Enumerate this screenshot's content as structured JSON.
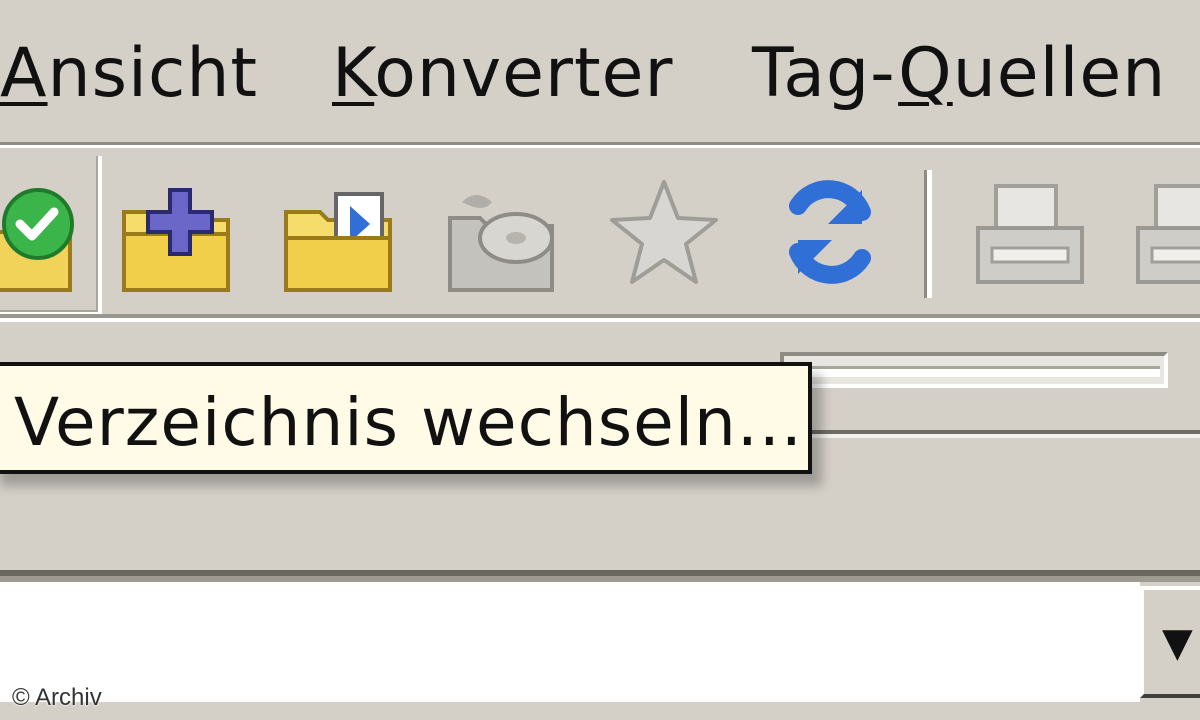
{
  "menubar": {
    "items": [
      {
        "label_underlined": "A",
        "label_rest": "nsicht"
      },
      {
        "label_underlined": "K",
        "label_rest": "onverter"
      },
      {
        "label_prefix": "Tag-",
        "label_underlined": "Q",
        "label_rest": "uellen"
      }
    ]
  },
  "toolbar": {
    "buttons": [
      {
        "icon": "folder-check-icon"
      },
      {
        "icon": "folder-add-icon"
      },
      {
        "icon": "folder-open-icon"
      },
      {
        "icon": "folder-cd-icon"
      },
      {
        "icon": "star-icon"
      },
      {
        "icon": "refresh-icon"
      },
      {
        "icon": "printer-icon"
      },
      {
        "icon": "printer-2-icon"
      }
    ]
  },
  "tooltip": {
    "text": "Verzeichnis wechseln..."
  },
  "input": {
    "dropdown_arrow": "▼"
  },
  "credit": "© Archiv",
  "colors": {
    "window_bg": "#d4d0c8",
    "tooltip_bg": "#fffbe6",
    "refresh_blue": "#2f6fd6",
    "folder_yellow": "#f2d35a",
    "check_green": "#3bb54a"
  }
}
